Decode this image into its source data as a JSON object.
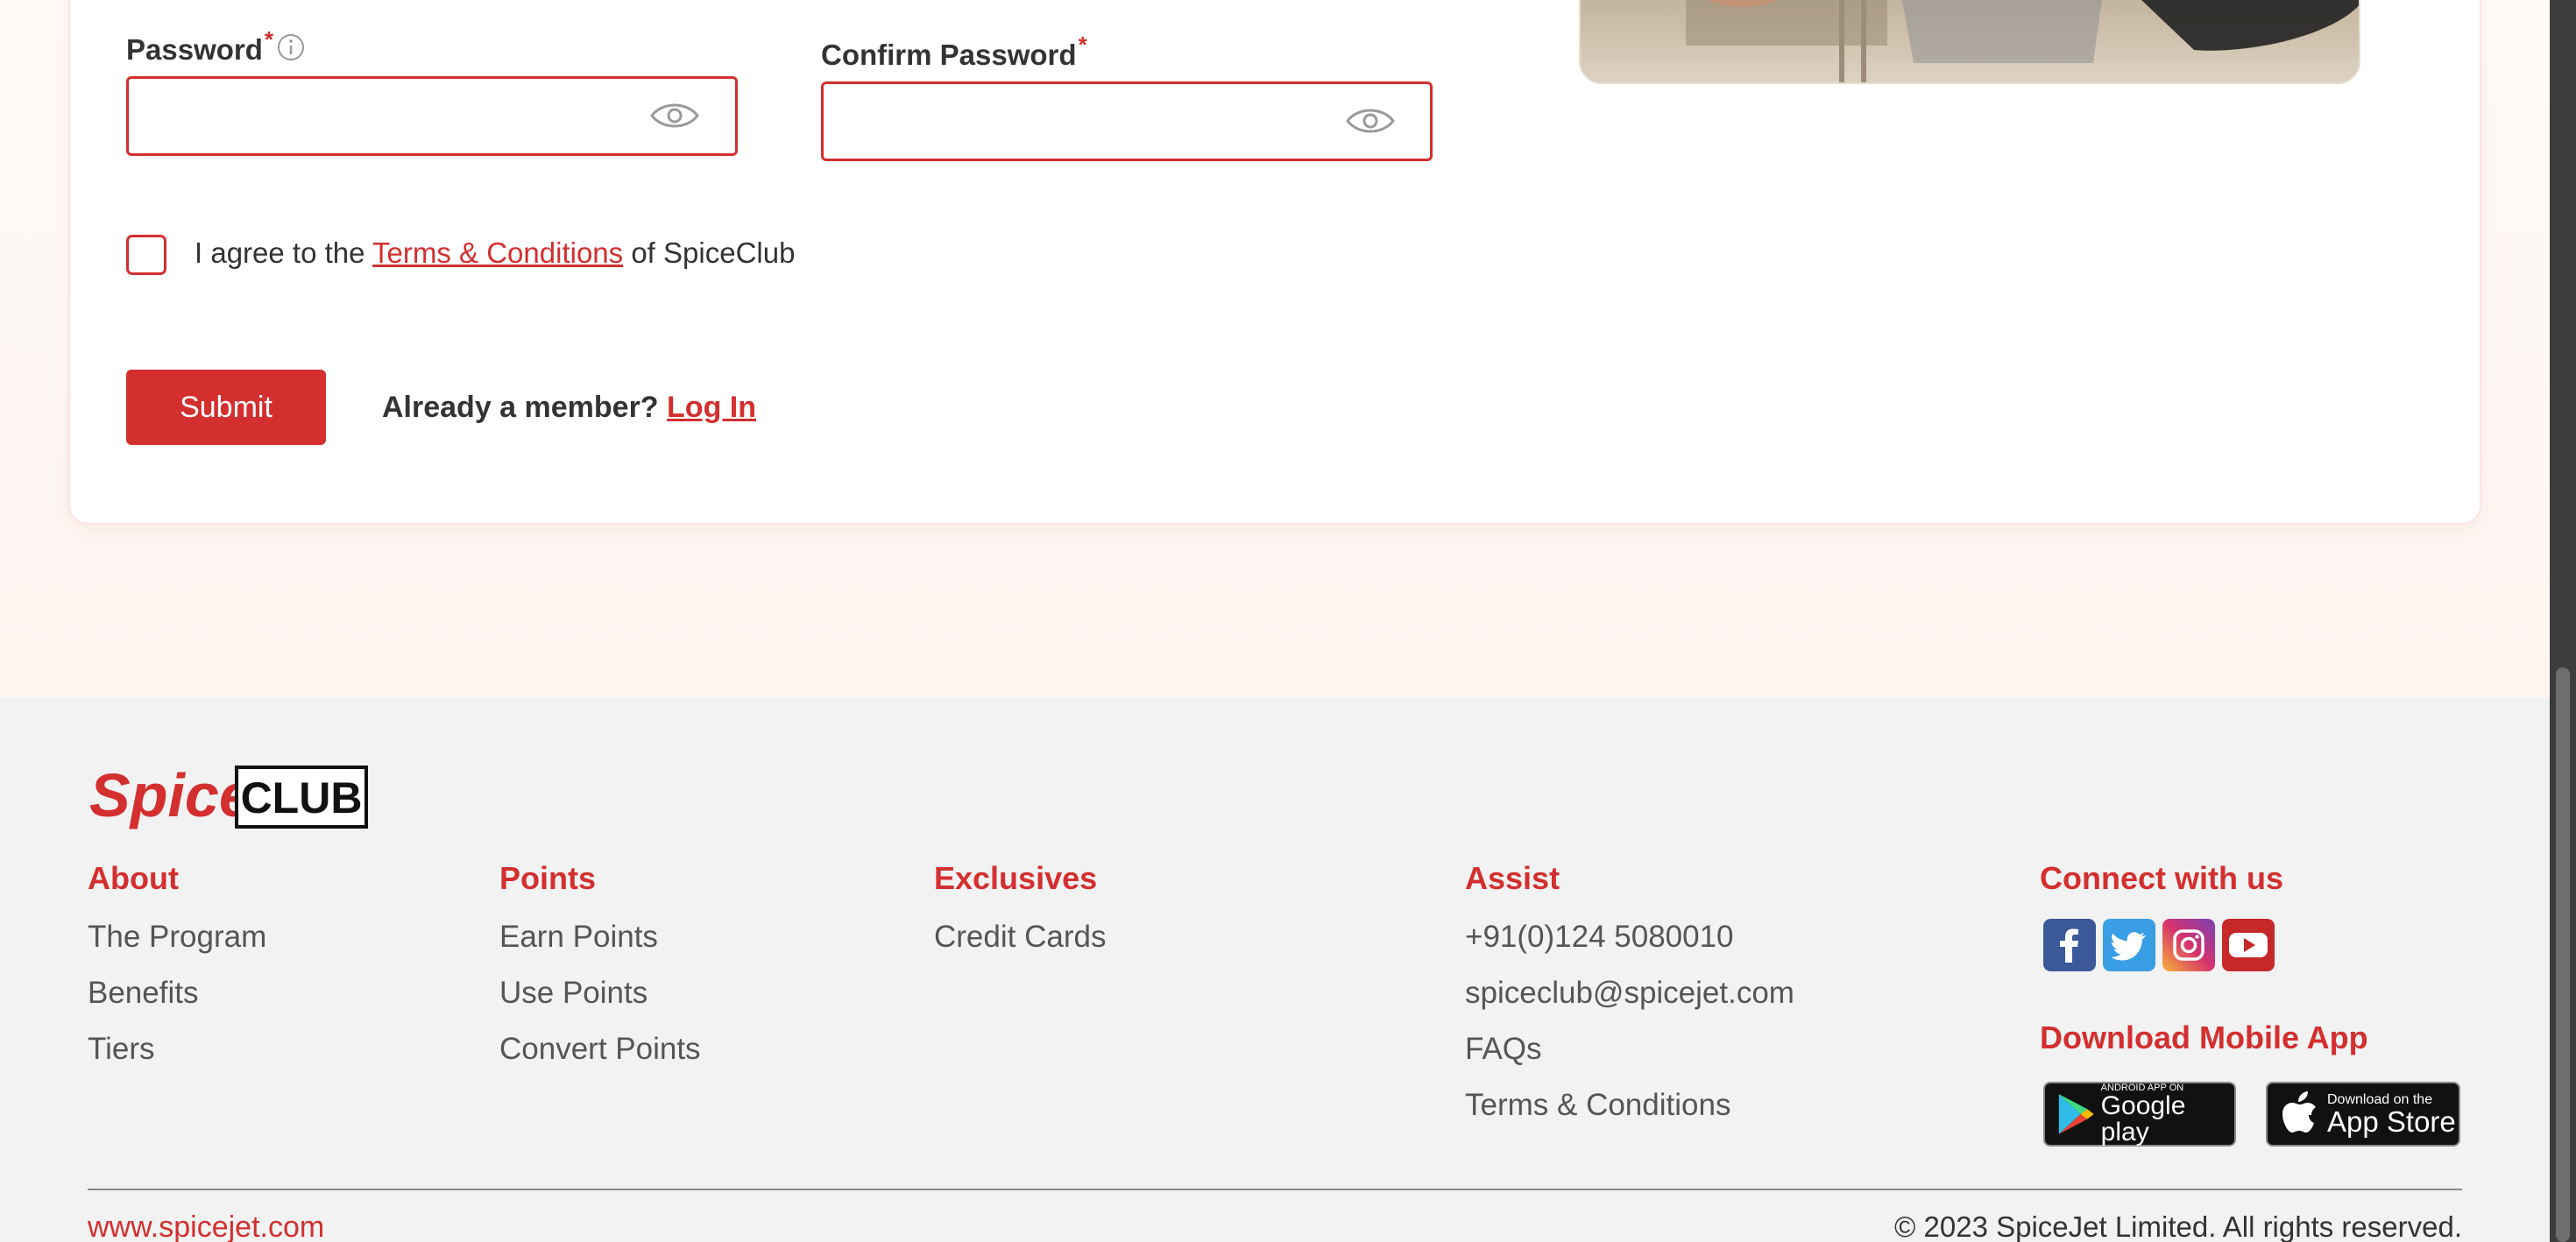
{
  "form": {
    "password_label": "Password",
    "password_value": "",
    "confirm_label": "Confirm Password",
    "confirm_value": "",
    "required_mark": "*",
    "agree_prefix": "I agree to the ",
    "agree_link": "Terms & Conditions",
    "agree_suffix": " of SpiceClub",
    "submit_label": "Submit",
    "member_prompt": "Already a member? ",
    "login_link": "Log In"
  },
  "footer": {
    "logo": {
      "spice": "Spice",
      "club": "CLUB"
    },
    "columns": [
      {
        "heading": "About",
        "links": [
          "The Program",
          "Benefits",
          "Tiers"
        ]
      },
      {
        "heading": "Points",
        "links": [
          "Earn Points",
          "Use Points",
          "Convert Points"
        ]
      },
      {
        "heading": "Exclusives",
        "links": [
          "Credit Cards"
        ]
      },
      {
        "heading": "Assist",
        "links": [
          "+91(0)124 5080010",
          "spiceclub@spicejet.com",
          "FAQs",
          "Terms & Conditions"
        ]
      }
    ],
    "connect_heading": "Connect with us",
    "social_icons": [
      "facebook-icon",
      "twitter-icon",
      "instagram-icon",
      "youtube-icon"
    ],
    "download_heading": "Download Mobile App",
    "google_play": {
      "small": "ANDROID APP ON",
      "big": "Google play"
    },
    "app_store": {
      "small": "Download on the",
      "big": "App Store"
    },
    "website": "www.spicejet.com",
    "copyright": "© 2023 SpiceJet Limited. All rights reserved."
  },
  "colors": {
    "brand_red": "#d32f2f",
    "footer_bg": "#f2f2f2",
    "link_grey": "#555555"
  }
}
